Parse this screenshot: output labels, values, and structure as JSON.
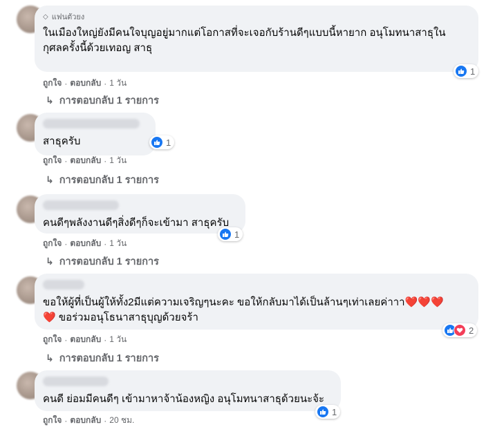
{
  "comments": [
    {
      "badge": "แฟนตัวยง",
      "text": "ในเมืองใหญ่ยังมีคนใจบุญอยู่มากแต่โอกาสที่จะเจอกับร้านดีๆแบบนี้หายาก อนุโมทนาสาธุใน\nกุศลครั้งนี้ด้วยเทอญ สาธุ",
      "like_label": "ถูกใจ",
      "reply_label": "ตอบกลับ",
      "time": "1 วัน",
      "reaction_count": "1",
      "replies_label": "การตอบกลับ 1 รายการ"
    },
    {
      "text": "สาธุครับ",
      "like_label": "ถูกใจ",
      "reply_label": "ตอบกลับ",
      "time": "1 วัน",
      "reaction_count": "1",
      "replies_label": "การตอบกลับ 1 รายการ"
    },
    {
      "text": "คนดีๆพลังงานดีๆสิ่งดีๆก็จะเข้ามา สาธุครับ",
      "like_label": "ถูกใจ",
      "reply_label": "ตอบกลับ",
      "time": "1 วัน",
      "reaction_count": "1",
      "replies_label": "การตอบกลับ 1 รายการ"
    },
    {
      "text_line1": "ขอให้ผู้ที่เป็นผู้ให้ทั้ง2มีแต่ความเจริญๆนะคะ ขอให้กลับมาได้เป็นล้านๆเท่าเลยค่าาา",
      "hearts1": "❤️❤️❤️",
      "hearts2": "❤️",
      "text_line2": " ขอร่วมอนุโธนาสาธุบุญด้วยจร้า",
      "like_label": "ถูกใจ",
      "reply_label": "ตอบกลับ",
      "time": "1 วัน",
      "reaction_count": "2",
      "replies_label": "การตอบกลับ 1 รายการ"
    },
    {
      "text": "คนดี ย่อมมีคนดีๆ เข้ามาหาจ้าน้องหญิง อนุโมทนาสาธุด้วยนะจ้ะ",
      "like_label": "ถูกใจ",
      "reply_label": "ตอบกลับ",
      "time": "20 ชม.",
      "reaction_count": "1"
    }
  ],
  "colors": {
    "bubble": "#f0f2f5",
    "like": "#1877f2",
    "love": "#f33e58",
    "secondary_text": "#65676b"
  },
  "icons": [
    "diamond-icon",
    "like-icon",
    "love-icon",
    "reply-arrow-icon"
  ]
}
